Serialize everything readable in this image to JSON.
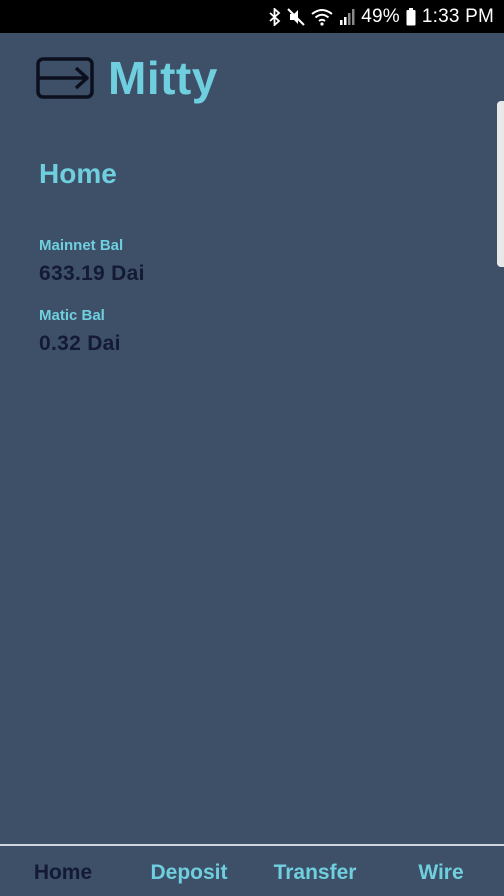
{
  "status_bar": {
    "battery": "49%",
    "time": "1:33 PM",
    "icons": [
      "bluetooth-icon",
      "mute-icon",
      "wifi-icon",
      "signal-icon",
      "battery-icon"
    ]
  },
  "app": {
    "title": "Mitty",
    "logo_icon": "card-transfer-icon",
    "accent_color": "#6fcfdf",
    "background_color": "#3d5068"
  },
  "page": {
    "title": "Home",
    "balances": [
      {
        "label": "Mainnet Bal",
        "value": "633.19 Dai"
      },
      {
        "label": "Matic Bal",
        "value": "0.32 Dai"
      }
    ]
  },
  "nav": {
    "items": [
      {
        "label": "Home",
        "active": true
      },
      {
        "label": "Deposit",
        "active": false
      },
      {
        "label": "Transfer",
        "active": false
      },
      {
        "label": "Wire",
        "active": false
      }
    ]
  }
}
